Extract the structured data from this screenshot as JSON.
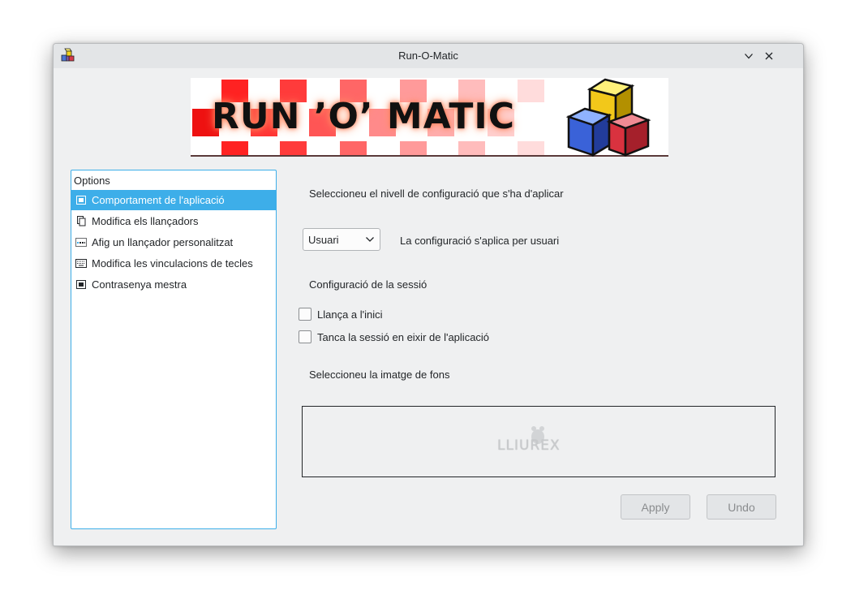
{
  "window": {
    "title": "Run-O-Matic"
  },
  "banner": {
    "text": "RUN ’O’ MATIC"
  },
  "options": {
    "header": "Options",
    "items": [
      {
        "label": "Comportament de l'aplicació",
        "icon": "app-behavior-icon",
        "selected": true
      },
      {
        "label": "Modifica els llançadors",
        "icon": "copy-icon",
        "selected": false
      },
      {
        "label": "Afig un llançador personalitzat",
        "icon": "custom-launcher-icon",
        "selected": false
      },
      {
        "label": "Modifica les vinculacions de tecles",
        "icon": "keyboard-icon",
        "selected": false
      },
      {
        "label": "Contrasenya mestra",
        "icon": "password-icon",
        "selected": false
      }
    ]
  },
  "main": {
    "config_level_label": "Seleccioneu el nivell de configuració que s'ha d'aplicar",
    "config_level_value": "Usuari",
    "config_level_desc": "La configuració s'aplica per usuari",
    "session_label": "Configuració de la sessió",
    "launch_at_start": "Llança a l'inici",
    "close_session": "Tanca la sessió en eixir de l'aplicació",
    "background_label": "Seleccioneu la imatge de fons",
    "background_logo": "LLIUREX"
  },
  "buttons": {
    "apply": "Apply",
    "undo": "Undo"
  },
  "colors": {
    "accent": "#3daee9",
    "window_bg": "#eff0f1"
  }
}
